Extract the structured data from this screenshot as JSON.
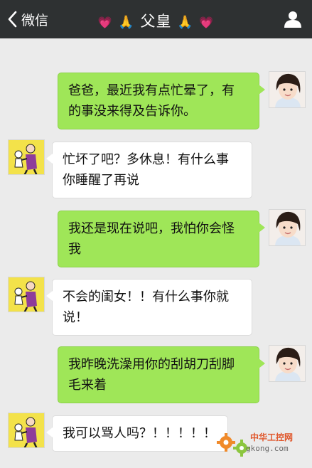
{
  "header": {
    "back_label": "微信",
    "title_heart_left": "💗",
    "title_pray_left": "🙏",
    "title_text": "父皇",
    "title_pray_right": "🙏",
    "title_heart_right": "💗",
    "back_icon": "chevron-left-icon",
    "profile_icon": "person-icon"
  },
  "messages": [
    {
      "sender": "me",
      "lines": [
        "爸爸，最近我有点忙晕了，有",
        "的事没来得及告诉你。"
      ]
    },
    {
      "sender": "them",
      "lines": [
        "忙坏了吧？多休息！有什么事",
        "你睡醒了再说"
      ]
    },
    {
      "sender": "me",
      "lines": [
        "我还是现在说吧，我怕你会怪",
        "我"
      ]
    },
    {
      "sender": "them",
      "lines": [
        "不会的闺女！！有什么事你就",
        "说！"
      ]
    },
    {
      "sender": "me",
      "lines": [
        "我昨晚洗澡用你的刮胡刀刮脚",
        "毛来着"
      ]
    },
    {
      "sender": "them",
      "lines": [
        "我可以骂人吗？！！！！！"
      ]
    }
  ],
  "watermark": {
    "line1": "中华工控网",
    "line2": "gkong.com"
  },
  "colors": {
    "topbar": "#2e3132",
    "background": "#ebebeb",
    "my_bubble": "#9fe658",
    "their_bubble": "#ffffff",
    "watermark_gear": "#f08a2a"
  }
}
